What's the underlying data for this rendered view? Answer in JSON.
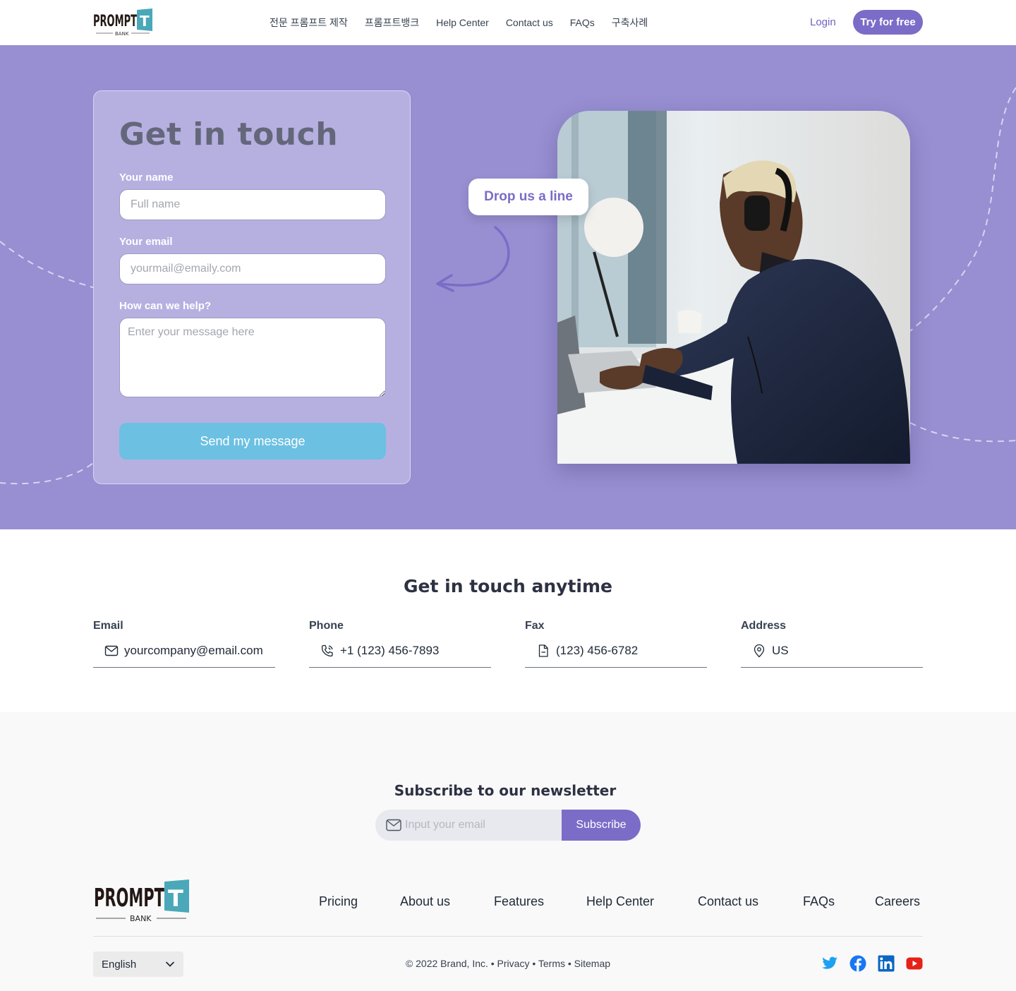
{
  "header": {
    "logo_text": "PROMPT",
    "logo_sub": "BANK",
    "nav": [
      "전문 프롬프트 제작",
      "프롬프트뱅크",
      "Help Center",
      "Contact us",
      "FAQs",
      "구축사례"
    ],
    "login": "Login",
    "cta": "Try for free"
  },
  "hero": {
    "title": "Get in touch",
    "name_label": "Your name",
    "name_placeholder": "Full name",
    "email_label": "Your email",
    "email_placeholder": "yourmail@emaily.com",
    "help_label": "How can we help?",
    "help_placeholder": "Enter your message here",
    "send": "Send my message",
    "bubble": "Drop us a line"
  },
  "contact": {
    "title": "Get in touch anytime",
    "items": [
      {
        "label": "Email",
        "value": "yourcompany@email.com",
        "icon": "mail-icon"
      },
      {
        "label": "Phone",
        "value": "+1 (123) 456-7893",
        "icon": "phone-icon"
      },
      {
        "label": "Fax",
        "value": "(123) 456-6782",
        "icon": "document-icon"
      },
      {
        "label": "Address",
        "value": "US",
        "icon": "location-pin-icon"
      }
    ]
  },
  "newsletter": {
    "title": "Subscribe to our newsletter",
    "placeholder": "Input your email",
    "button": "Subscribe"
  },
  "footer": {
    "logo_text": "PROMPT",
    "logo_sub": "BANK",
    "links": [
      "Pricing",
      "About us",
      "Features",
      "Help Center",
      "Contact us",
      "FAQs",
      "Careers"
    ],
    "language": "English",
    "copyright": "© 2022 Brand, Inc. • Privacy • Terms • Sitemap",
    "social": [
      "twitter-icon",
      "facebook-icon",
      "linkedin-icon",
      "youtube-icon"
    ]
  },
  "colors": {
    "hero_bg": "#978fd1",
    "form_card": "#b6b0e1",
    "accent": "#7b6cc8",
    "send_button": "#6cc0e2"
  }
}
